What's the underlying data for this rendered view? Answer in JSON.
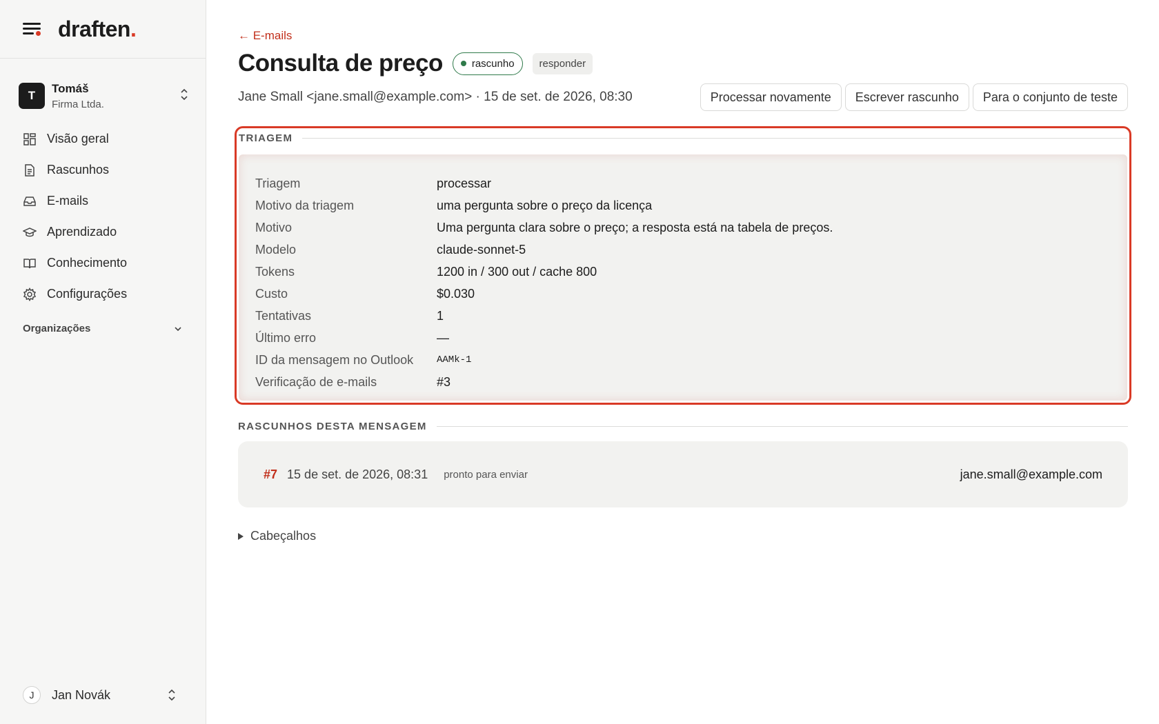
{
  "app": {
    "brand_name": "draften",
    "brand_dot": ".",
    "accent_color": "#d93a26"
  },
  "sidebar": {
    "org": {
      "avatar_letter": "T",
      "name": "Tomáš",
      "subtitle": "Firma Ltda."
    },
    "nav": [
      {
        "label": "Visão geral",
        "icon": "grid-icon"
      },
      {
        "label": "Rascunhos",
        "icon": "document-icon"
      },
      {
        "label": "E-mails",
        "icon": "inbox-icon"
      },
      {
        "label": "Aprendizado",
        "icon": "graduation-cap-icon"
      },
      {
        "label": "Conhecimento",
        "icon": "book-icon"
      },
      {
        "label": "Configurações",
        "icon": "gear-icon"
      }
    ],
    "organizations_label": "Organizações",
    "user": {
      "avatar_letter": "J",
      "name": "Jan Novák"
    }
  },
  "page": {
    "back_link": "← E-mails",
    "title": "Consulta de preço",
    "status_badge": "rascunho",
    "status_color": "#2f7a4a",
    "action_badge": "responder",
    "meta": "Jane Small <jane.small@example.com> · 15 de set. de 2026, 08:30",
    "buttons": {
      "reprocess": "Processar novamente",
      "write_draft": "Escrever rascunho",
      "to_test_set": "Para o conjunto de teste"
    }
  },
  "triage": {
    "section_label": "TRIAGEM",
    "rows": [
      {
        "key": "Triagem",
        "value": "processar"
      },
      {
        "key": "Motivo da triagem",
        "value": "uma pergunta sobre o preço da licença"
      },
      {
        "key": "Motivo",
        "value": "Uma pergunta clara sobre o preço; a resposta está na tabela de preços."
      },
      {
        "key": "Modelo",
        "value": "claude-sonnet-5"
      },
      {
        "key": "Tokens",
        "value": "1200 in / 300 out / cache 800"
      },
      {
        "key": "Custo",
        "value": "$0.030"
      },
      {
        "key": "Tentativas",
        "value": "1"
      },
      {
        "key": "Último erro",
        "value": "—"
      },
      {
        "key": "ID da mensagem no Outlook",
        "value": "AAMk-1"
      },
      {
        "key": "Verificação de e-mails",
        "value": "#3"
      }
    ]
  },
  "drafts": {
    "section_label": "RASCUNHOS DESTA MENSAGEM",
    "items": [
      {
        "number": "#7",
        "date": "15 de set. de 2026, 08:31",
        "status": "pronto para enviar",
        "recipient": "jane.small@example.com"
      }
    ]
  },
  "headers_toggle": "Cabeçalhos"
}
